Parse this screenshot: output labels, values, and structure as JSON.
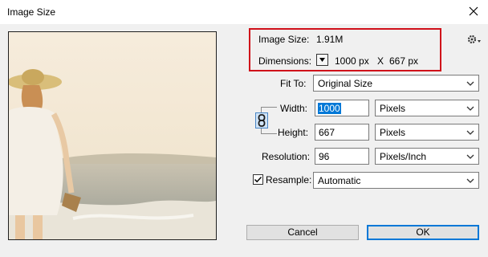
{
  "window": {
    "title": "Image Size",
    "close_icon": "close-icon"
  },
  "info": {
    "image_size_label": "Image Size:",
    "image_size_value": "1.91M",
    "dimensions_label": "Dimensions:",
    "dimensions_width": "1000 px",
    "dimensions_sep": "X",
    "dimensions_height": "667 px",
    "highlight_color": "#d0101a"
  },
  "fit_to": {
    "label": "Fit To:",
    "value": "Original Size"
  },
  "width": {
    "label": "Width:",
    "value": "1000",
    "unit": "Pixels"
  },
  "height": {
    "label": "Height:",
    "value": "667",
    "unit": "Pixels"
  },
  "resolution": {
    "label": "Resolution:",
    "value": "96",
    "unit": "Pixels/Inch"
  },
  "resample": {
    "label": "Resample:",
    "checked": true,
    "value": "Automatic"
  },
  "buttons": {
    "cancel": "Cancel",
    "ok": "OK"
  },
  "colors": {
    "accent": "#0078d7",
    "selection": "#0078d7"
  }
}
